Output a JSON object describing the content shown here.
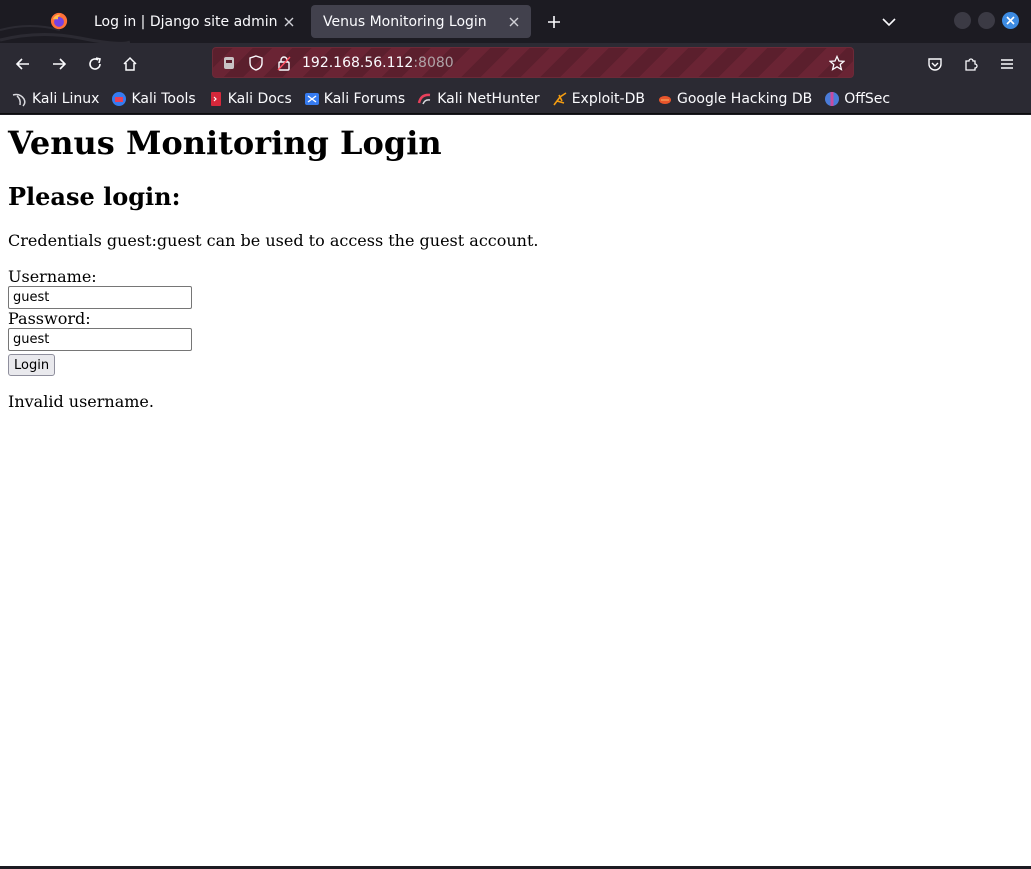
{
  "browser": {
    "tabs": [
      {
        "title": "Log in | Django site admin",
        "active": false
      },
      {
        "title": "Venus Monitoring Login",
        "active": true
      }
    ],
    "url": {
      "host": "192.168.56.112",
      "port": ":8080"
    },
    "bookmarks": [
      {
        "label": "Kali Linux",
        "icon": "kali-dragon-icon"
      },
      {
        "label": "Kali Tools",
        "icon": "kali-tools-icon"
      },
      {
        "label": "Kali Docs",
        "icon": "kali-docs-icon"
      },
      {
        "label": "Kali Forums",
        "icon": "kali-forums-icon"
      },
      {
        "label": "Kali NetHunter",
        "icon": "kali-nethunter-icon"
      },
      {
        "label": "Exploit-DB",
        "icon": "exploit-db-icon"
      },
      {
        "label": "Google Hacking DB",
        "icon": "ghdb-icon"
      },
      {
        "label": "OffSec",
        "icon": "offsec-icon"
      }
    ],
    "colors": {
      "chrome_dark": "#1c1b22",
      "toolbar": "#2b2a33",
      "active_tab": "#42414d",
      "close_accent": "#3d8be2"
    }
  },
  "page": {
    "heading": "Venus Monitoring Login",
    "subheading": "Please login:",
    "credentials_hint": "Credentials guest:guest can be used to access the guest account.",
    "username_label": "Username:",
    "username_value": "guest",
    "password_label": "Password:",
    "password_value": "guest",
    "login_button": "Login",
    "message": "Invalid username."
  }
}
